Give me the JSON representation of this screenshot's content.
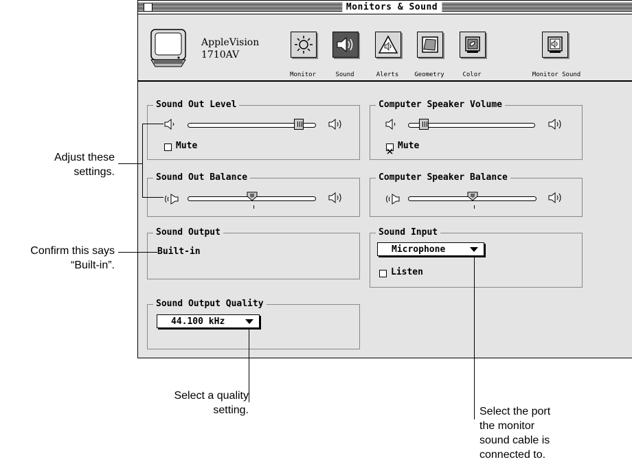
{
  "window": {
    "title": "Monitors & Sound"
  },
  "monitor": {
    "name_line1": "AppleVision",
    "name_line2": "1710AV"
  },
  "toolbar": {
    "buttons": [
      {
        "label": "Monitor",
        "icon": "sun-icon"
      },
      {
        "label": "Sound",
        "icon": "speaker-icon",
        "selected": true
      },
      {
        "label": "Alerts",
        "icon": "alert-triangle-icon"
      },
      {
        "label": "Geometry",
        "icon": "geometry-icon"
      },
      {
        "label": "Color",
        "icon": "color-icon"
      },
      {
        "label": "Monitor Sound",
        "icon": "monitor-speaker-icon"
      }
    ]
  },
  "sound_out_level": {
    "title": "Sound Out Level",
    "value": 0.87,
    "mute_label": "Mute",
    "mute_checked": false
  },
  "speaker_volume": {
    "title": "Computer Speaker Volume",
    "value": 0.13,
    "mute_label": "Mute",
    "mute_checked": true
  },
  "sound_out_balance": {
    "title": "Sound Out Balance",
    "value": 0.5
  },
  "speaker_balance": {
    "title": "Computer Speaker Balance",
    "value": 0.5
  },
  "sound_output": {
    "title": "Sound Output",
    "value": "Built-in"
  },
  "sound_input": {
    "title": "Sound Input",
    "selected": "Microphone",
    "listen_label": "Listen",
    "listen_checked": false
  },
  "sound_output_quality": {
    "title": "Sound Output Quality",
    "selected": "44.100 kHz"
  },
  "callouts": {
    "adjust_1": "Adjust these",
    "adjust_2": "settings.",
    "confirm_1": "Confirm this says",
    "confirm_2": "“Built-in”.",
    "quality_1": "Select a quality",
    "quality_2": "setting.",
    "port_1": "Select the port",
    "port_2": "the monitor",
    "port_3": "sound cable is",
    "port_4": "connected to."
  }
}
